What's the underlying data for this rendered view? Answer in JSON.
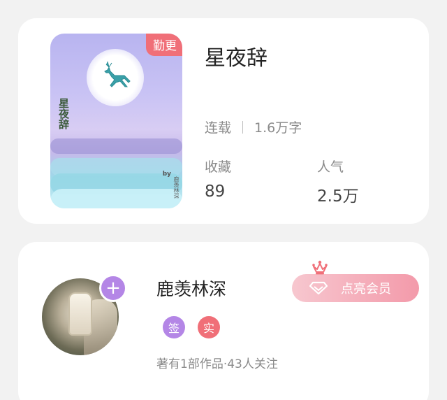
{
  "book": {
    "update_badge": "勤更",
    "title": "星夜辞",
    "status": "连载",
    "word_count": "1.6万字",
    "favorites_label": "收藏",
    "favorites_value": "89",
    "popularity_label": "人气",
    "popularity_value": "2.5万",
    "cover": {
      "title": "星夜辞",
      "by": "by",
      "author": "鹿羡林深"
    }
  },
  "author": {
    "name": "鹿羡林深",
    "follow_symbol": "+",
    "badge_signed": "签",
    "badge_verified": "实",
    "stats": "著有1部作品·43人关注",
    "vip_button": "点亮会员"
  },
  "colors": {
    "accent_red": "#f06f78",
    "accent_purple": "#b486e6",
    "vip_pink": "#f39aaa"
  },
  "icons": {
    "follow": "plus-icon",
    "crown": "crown-icon",
    "diamond": "diamond-icon",
    "deer": "deer-icon"
  }
}
